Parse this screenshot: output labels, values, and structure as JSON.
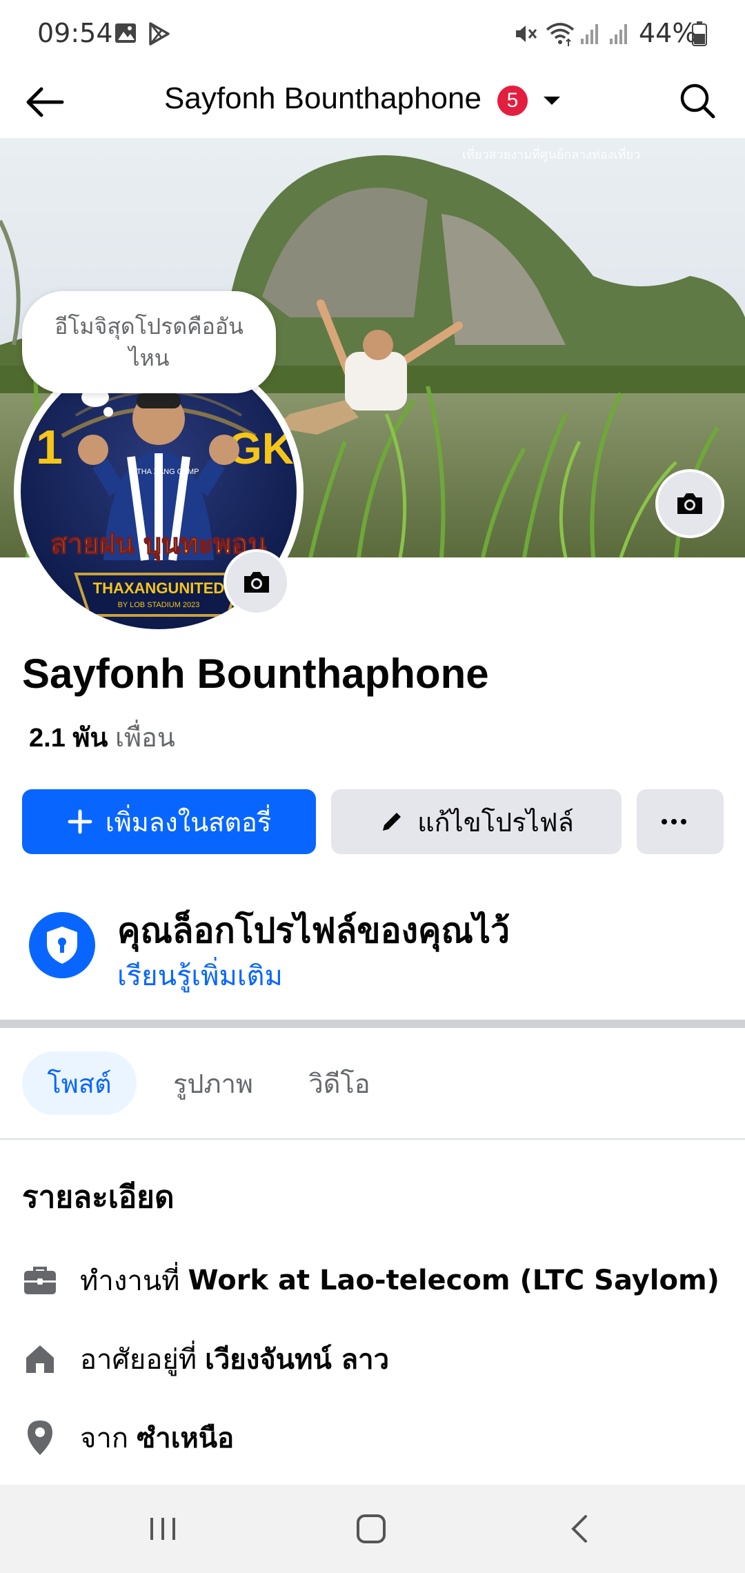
{
  "status_bar": {
    "time": "09:54",
    "battery_percent": "44%",
    "icons": [
      "gallery-icon",
      "play-store-icon",
      "mute-icon",
      "wifi-icon",
      "signal-icon",
      "signal-icon",
      "battery-icon"
    ]
  },
  "header": {
    "title": "Sayfonh Bounthaphone",
    "notification_count": "5"
  },
  "profile": {
    "note_bubble": "อีโมจิสุดโปรดคืออันไหน",
    "name": "Sayfonh Bounthaphone",
    "friends_count": "2.1 พัน",
    "friends_label": "เพื่อน"
  },
  "actions": {
    "add_story": "เพิ่มลงในสตอรี่",
    "edit_profile": "แก้ไขโปรไฟล์",
    "more": "···"
  },
  "lock_notice": {
    "title": "คุณล็อกโปรไฟล์ของคุณไว้",
    "link": "เรียนรู้เพิ่มเติม"
  },
  "tabs": [
    {
      "label": "โพสต์",
      "active": true
    },
    {
      "label": "รูปภาพ",
      "active": false
    },
    {
      "label": "วิดีโอ",
      "active": false
    }
  ],
  "details": {
    "heading": "รายละเอียด",
    "work": {
      "prefix": "ทำงานที่",
      "value": "Work at Lao-telecom (LTC Saylom)"
    },
    "home": {
      "prefix": "อาศัยอยู่ที่",
      "value": "เวียงจันทน์ ลาว"
    },
    "from": {
      "prefix": "จาก",
      "value": "ซำเหนือ"
    }
  },
  "avatar_art": {
    "left_text": "1",
    "right_text": "GK",
    "banner": "สายฝน บุนทะพอน",
    "shirt": "THA XANG CAMP",
    "badge": "THAXANGUNITED",
    "badge_sub": "BY LOB STADIUM 2023"
  },
  "colors": {
    "accent": "#0866ff",
    "badge_red": "#e41e3f",
    "secondary_button": "#e4e6eb",
    "secondary_text": "#65676b"
  }
}
